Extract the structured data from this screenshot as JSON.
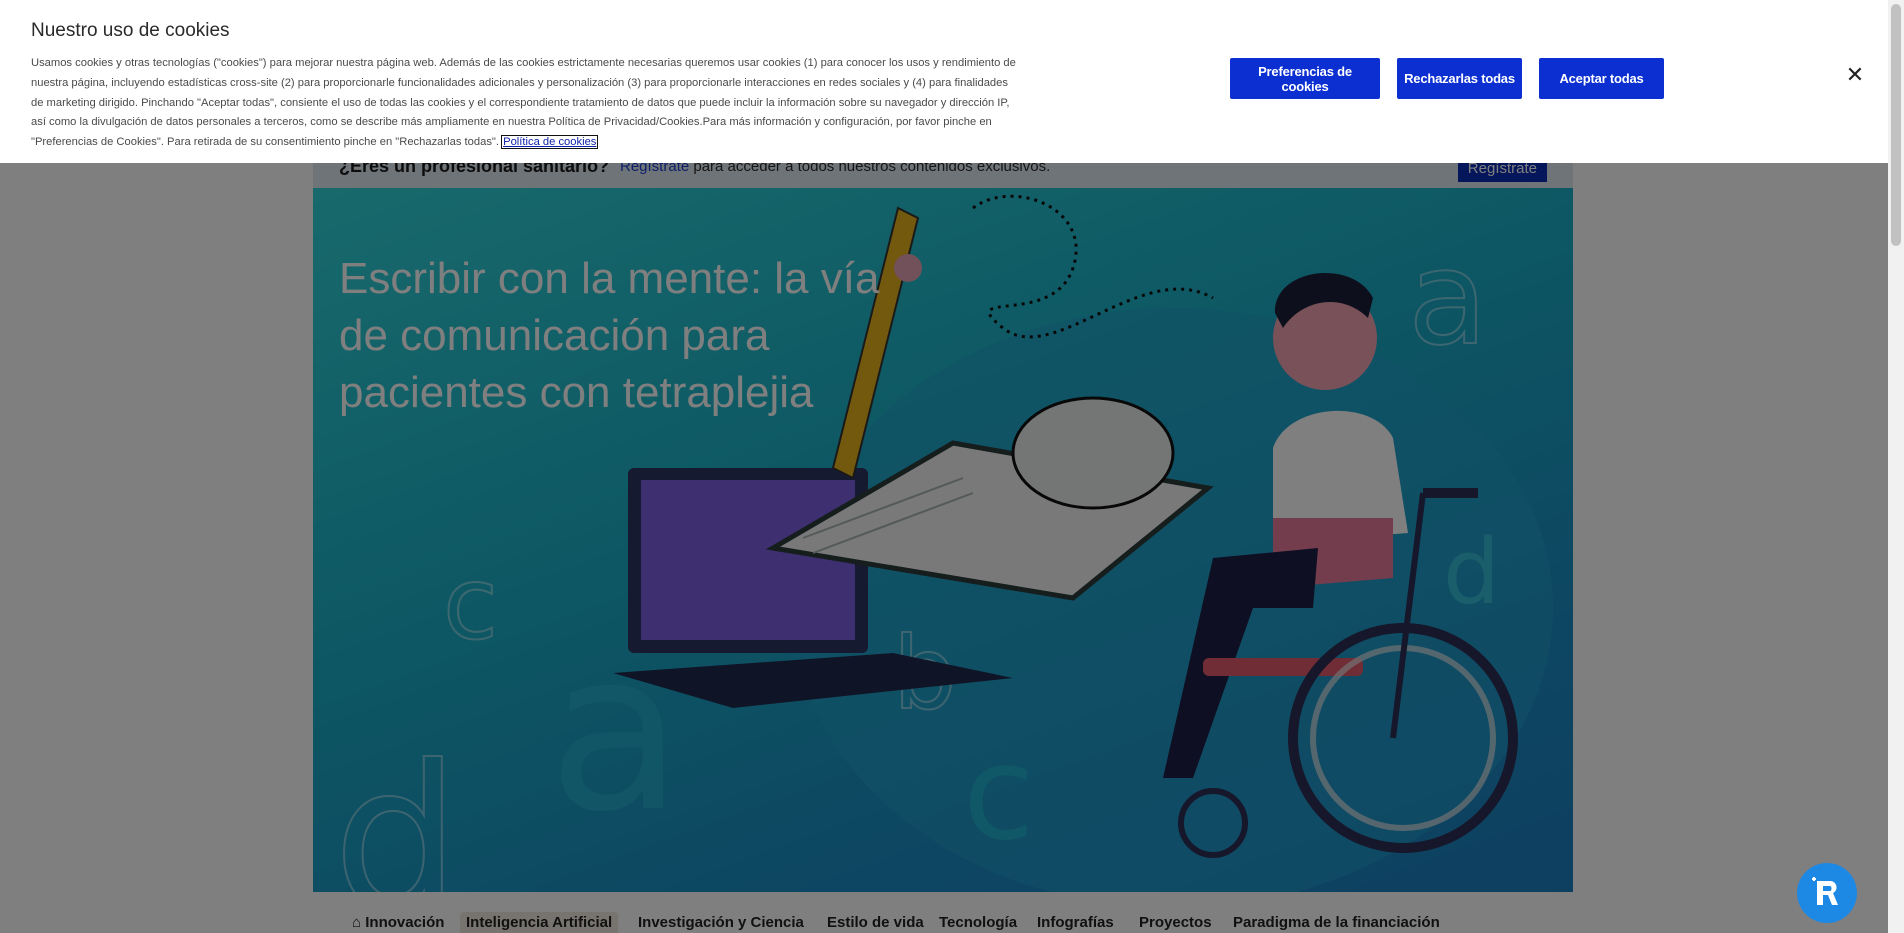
{
  "banner": {
    "question": "¿Eres un profesional sanitario?",
    "register_link": "Regístrate",
    "rest": " para acceder a todos nuestros contenidos exclusivos.",
    "register_button": "Regístrate"
  },
  "hero": {
    "title": "Escribir con la mente: la vía de comunicación para pacientes con tetraplejia"
  },
  "nav": {
    "items": [
      {
        "label": "Innovación",
        "icon": "home-icon"
      },
      {
        "label": "Inteligencia Artificial",
        "active": true
      },
      {
        "label": "Investigación y Ciencia"
      },
      {
        "label": "Estilo de vida"
      },
      {
        "label": "Tecnología"
      },
      {
        "label": "Infografías"
      },
      {
        "label": "Proyectos"
      },
      {
        "label": "Paradigma de la financiación"
      }
    ]
  },
  "cookie": {
    "title": "Nuestro uso de cookies",
    "text": "Usamos cookies y otras tecnologías (\"cookies\") para mejorar nuestra página web. Además de las cookies estrictamente necesarias queremos usar cookies (1) para conocer los usos y rendimiento de nuestra página, incluyendo estadísticas cross-site (2) para proporcionarle funcionalidades adicionales y personalización (3) para proporcionarle interacciones en redes sociales y (4) para finalidades de marketing dirigido. Pinchando \"Aceptar todas\", consiente el uso de todas las cookies y el correspondiente tratamiento de datos que puede incluir la información sobre su navegador y dirección IP, así como la divulgación de datos personales a terceros, como se describe más ampliamente en nuestra Política de Privacidad/Cookies.Para más información y configuración, por favor pinche en \"Preferencias de Cookies\". Para retirada de su consentimiento pinche en \"Rechazarlas todas\". ",
    "policy_link": "Política de cookies",
    "preferences_button": "Preferencias de cookies",
    "reject_button": "Rechazarlas todas",
    "accept_button": "Aceptar todas",
    "close_icon": "close-icon"
  },
  "colors": {
    "primary_button": "#0b2fd0",
    "fab": "#1e88e5"
  }
}
